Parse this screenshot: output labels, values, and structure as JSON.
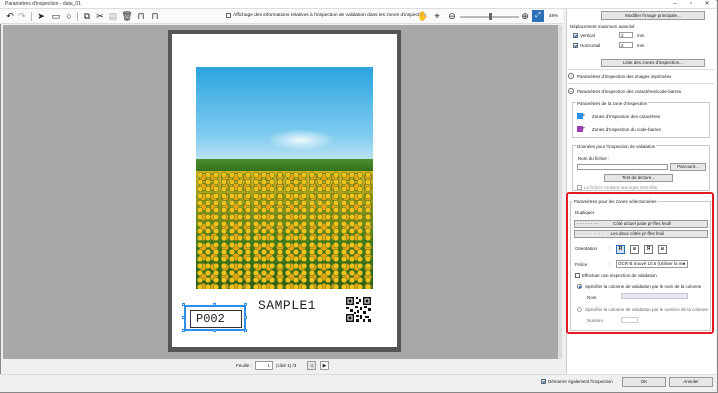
{
  "window": {
    "title": "Paramètres d'inspection - data_01"
  },
  "toolbar": {
    "overlay_label": "Affichage des informations relatives à l'inspection de validation dans les zones d'inspection",
    "zoom_percent": "49%",
    "zoom_level": 0.5
  },
  "document": {
    "sample_text": "SAMPLE1",
    "selected_field_text": "P002"
  },
  "pager": {
    "label": "Feuille :",
    "current": "1",
    "page_info": "(côté 1) /3"
  },
  "panel": {
    "modify_image_btn": "Modifier l'image principale...",
    "offset_title": "Déplacement maximum autorisé",
    "vertical_label": "Vertical",
    "vertical_value": "2",
    "horizontal_label": "Horizontal",
    "horizontal_value": "2",
    "unit_mm": "mm",
    "list_btn": "Liste des zones d'inspection...",
    "section_printed": "Paramètres d'inspection des images imprimées",
    "section_chars": "Paramètres d'inspection des caractères/code-barres",
    "zone_group_title": "Paramètres de la zone d'inspection",
    "zone_chars": "Zones d'inspection des caractères",
    "zone_barcodes": "Zones d'inspection du code-barres",
    "zone_chars_color": "#2d8ee8",
    "zone_barcodes_color": "#9b3fb5",
    "validation_group_title": "Données pour l'inspection de validation",
    "file_name_label": "Nom du fichier :",
    "browse_btn": "Parcourir...",
    "read_test_btn": "Test de lecture...",
    "header_checkbox": "Le fichier contient une ligne d'en-tête",
    "selected_title": "Paramètres pour les zones sélectionnées",
    "duplicate_label": "Dupliquer",
    "dup_right_btn": "Côté actuel juste pr-ffes feuill",
    "dup_both_btn": "Les deux côtés pr-ffes feuil",
    "orientation_label": "Orientation",
    "font_label": "Police",
    "font_value": "OCR-B trouvé 10.5 (Utiliser la mo",
    "validation_check": "Effectuer une inspection de validation",
    "radio_by_name": "Spécifier la colonne de validation par le nom de la colonne",
    "name_label": "Nom",
    "radio_by_number": "Spécifier la colonne de validation par le numéro de la colonne",
    "number_label": "Numéro"
  },
  "footer": {
    "start_checkbox": "Démarrer également l'inspection",
    "ok_btn": "OK",
    "cancel_btn": "Annuler"
  },
  "colors": {
    "highlight": "#e01b24",
    "selection": "#2d8ee8"
  }
}
